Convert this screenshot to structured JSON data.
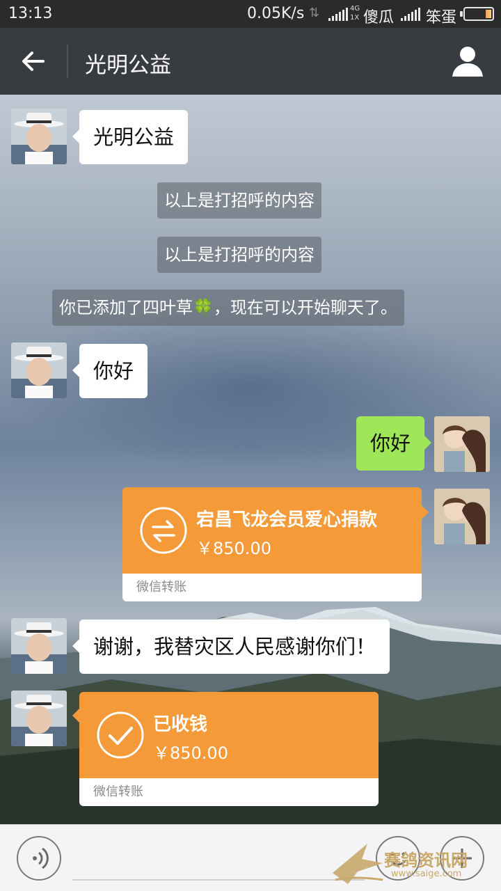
{
  "status_bar": {
    "time": "13:13",
    "speed": "0.05K/s",
    "network_tag": "4G",
    "network_tag2": "1X",
    "carrier1": "傻瓜",
    "carrier2": "笨蛋"
  },
  "header": {
    "title": "光明公益",
    "back_icon": "back-arrow-icon",
    "profile_icon": "person-icon"
  },
  "messages": [
    {
      "type": "text",
      "side": "left",
      "text": "光明公益"
    },
    {
      "type": "system",
      "text": "以上是打招呼的内容"
    },
    {
      "type": "system",
      "text": "以上是打招呼的内容"
    },
    {
      "type": "system",
      "text_before": "你已添加了四叶草",
      "emoji": "🍀",
      "text_after": "，现在可以开始聊天了。"
    },
    {
      "type": "text",
      "side": "left",
      "text": "你好"
    },
    {
      "type": "text",
      "side": "right",
      "text": "你好"
    },
    {
      "type": "transfer",
      "side": "right",
      "name": "宕昌飞龙会员爱心捐款",
      "amount": "￥850.00",
      "footer": "微信转账",
      "icon": "transfer-icon"
    },
    {
      "type": "text",
      "side": "left",
      "text": "谢谢，我替灾区人民感谢你们！"
    },
    {
      "type": "transfer",
      "side": "left",
      "name": "已收钱",
      "amount": "￥850.00",
      "footer": "微信转账",
      "icon": "checkmark-icon"
    }
  ],
  "input_bar": {
    "voice_icon": "voice-icon",
    "emoji_icon": "emoji-icon",
    "plus_icon": "plus-icon"
  },
  "watermark": {
    "text": "赛鸽资讯网",
    "url": "www.saige.com"
  },
  "colors": {
    "titlebar": "#383b40",
    "green_bubble": "#9fe658",
    "transfer_orange": "#f59a39"
  }
}
